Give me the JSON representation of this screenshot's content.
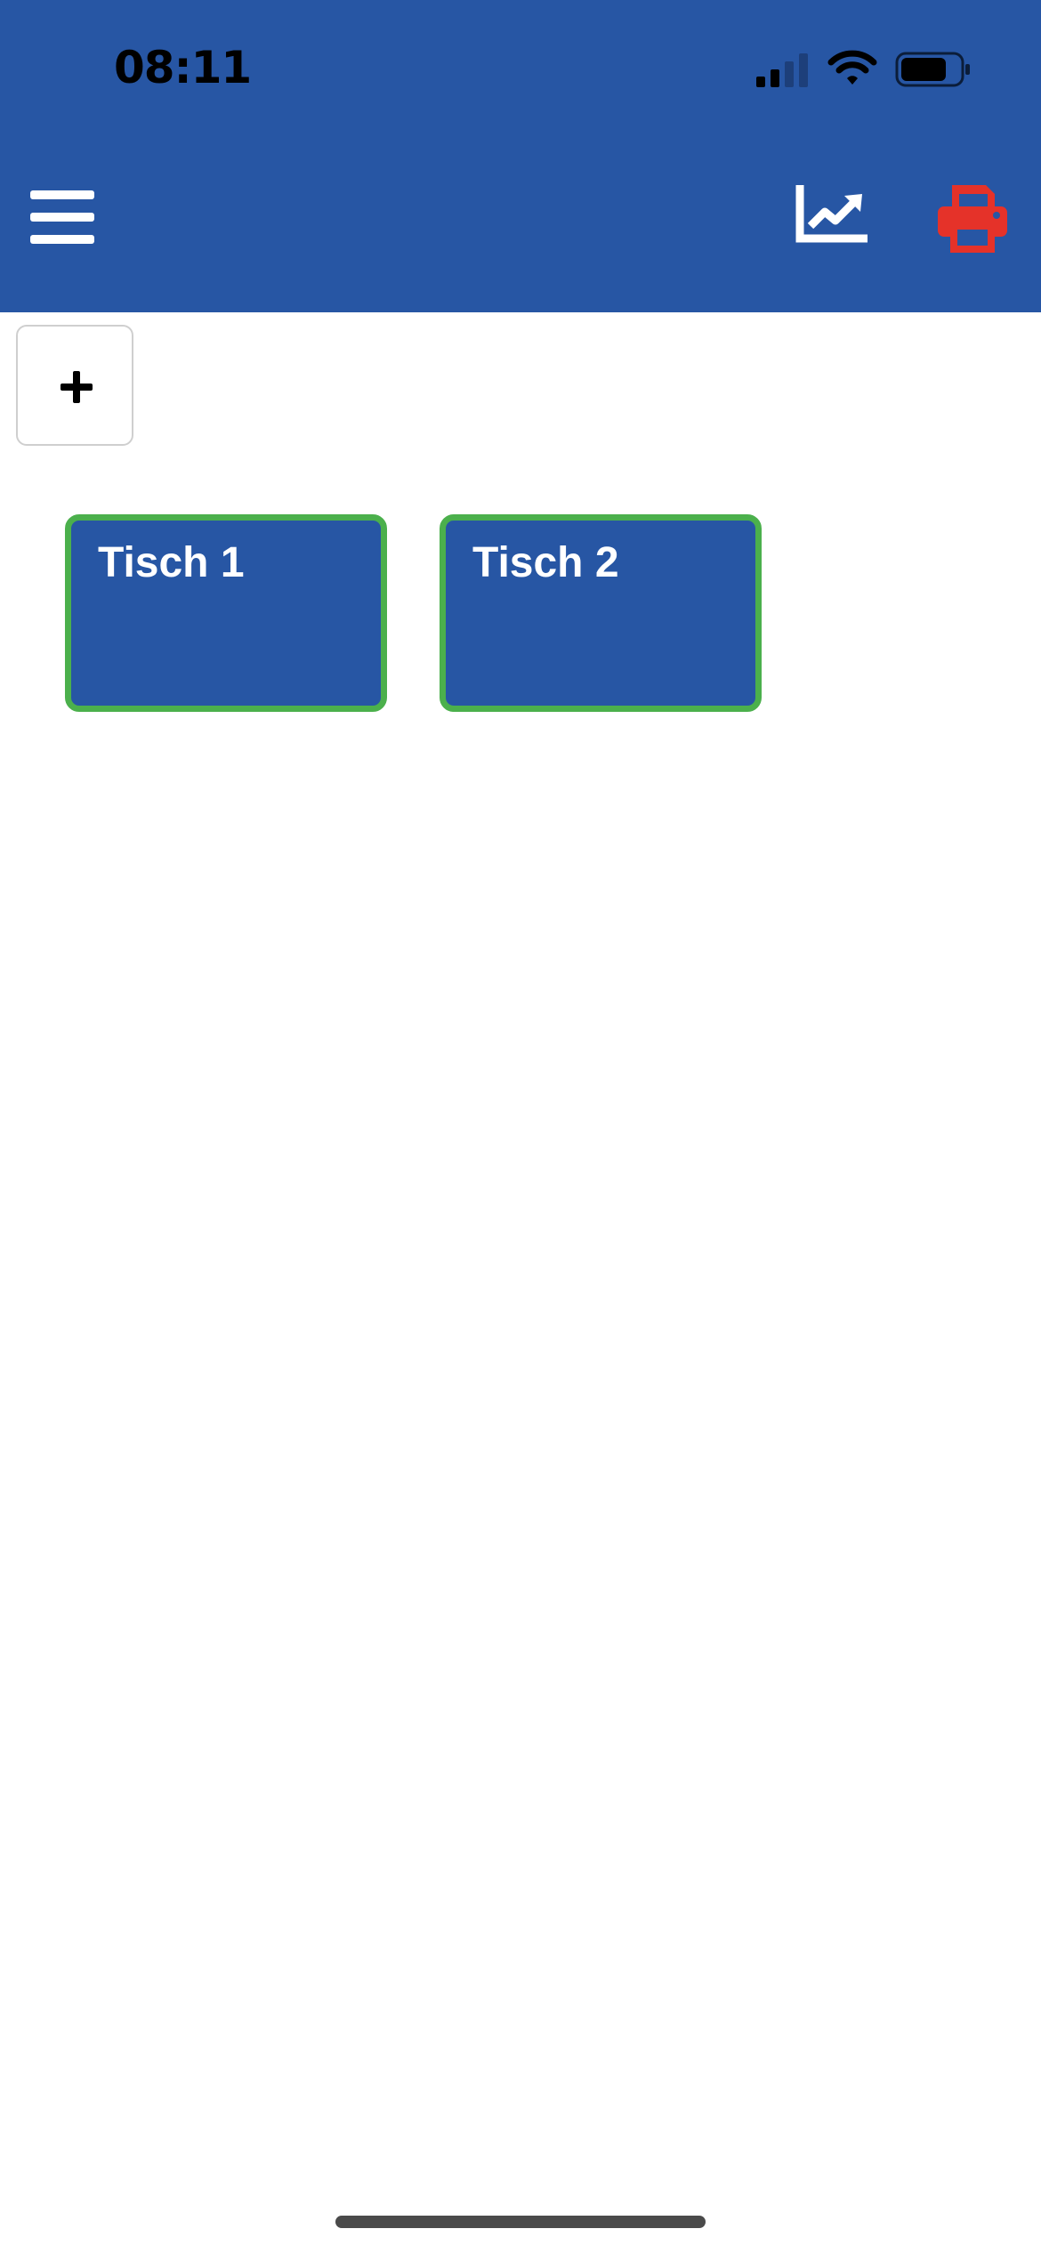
{
  "status_bar": {
    "time": "08:11",
    "icons": [
      "signal-icon",
      "wifi-icon",
      "battery-icon"
    ]
  },
  "header": {
    "background_color": "#2756a4",
    "menu_icon": "hamburger-menu-icon",
    "chart_icon": "line-chart-icon",
    "print_icon": "printer-icon",
    "print_icon_color": "#e53229"
  },
  "toolbar": {
    "add_label": "+"
  },
  "tables": [
    {
      "label": "Tisch 1"
    },
    {
      "label": "Tisch 2"
    }
  ],
  "colors": {
    "card_background": "#2756a4",
    "card_border": "#4bb04c"
  }
}
